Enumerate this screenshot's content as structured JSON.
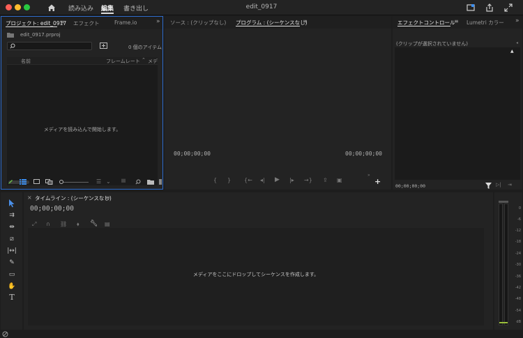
{
  "topbar": {
    "workspace_tabs": [
      {
        "label": "読み込み",
        "active": false
      },
      {
        "label": "編集",
        "active": true
      },
      {
        "label": "書き出し",
        "active": false
      }
    ],
    "project_title": "edit_0917"
  },
  "project_panel": {
    "tabs": [
      "プロジェクト: edit_0917",
      "エフェクト",
      "Frame.io"
    ],
    "file_name": "edit_0917.prproj",
    "item_count": "0 個のアイテム",
    "columns": [
      "名前",
      "フレームレート",
      "メデ"
    ],
    "empty_message": "メディアを読み込んで開始します。"
  },
  "source_panel": {
    "tab": "ソース : (クリップなし)"
  },
  "program_panel": {
    "tab": "プログラム : (シーケンスなし)",
    "timecode_left": "00;00;00;00",
    "timecode_right": "00;00;00;00"
  },
  "effect_controls": {
    "tabs": [
      "エフェクトコントロール",
      "Lumetri カラー"
    ],
    "no_clip": "(クリップが選択されていません)",
    "timecode": "00;00;00;00"
  },
  "timeline": {
    "tab": "タイムライン : (シーケンスなし)",
    "timecode": "00;00;00;00",
    "drop_message": "メディアをここにドロップしてシーケンスを作成します。"
  },
  "audio_meter": {
    "ticks": [
      "0",
      "-6",
      "-12",
      "-18",
      "-24",
      "-30",
      "-36",
      "-42",
      "-48",
      "-54",
      "dB"
    ]
  },
  "colors": {
    "accent_blue": "#2d6ccd",
    "selection_tool": "#4a8fe8",
    "meter_green": "#9bbf3a"
  }
}
